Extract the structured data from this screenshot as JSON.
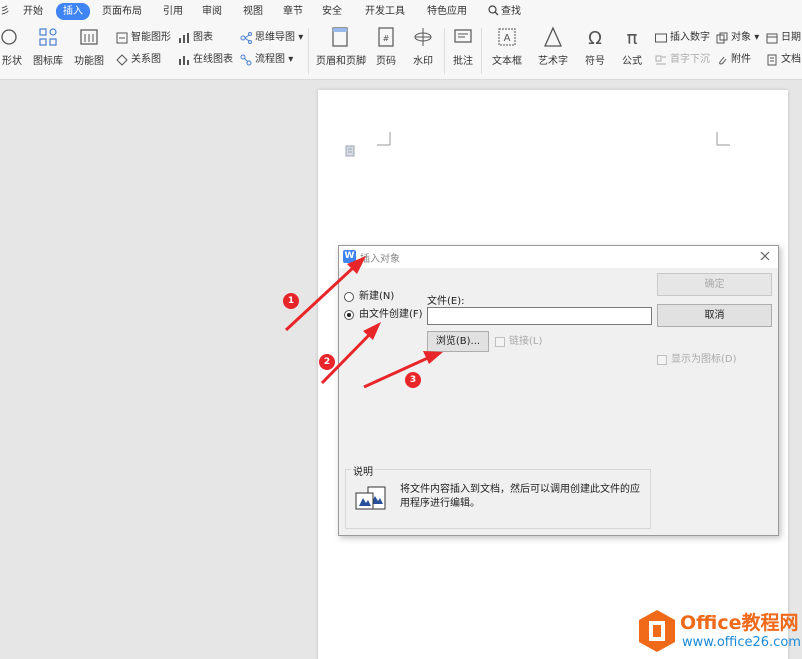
{
  "menu": {
    "tabs": [
      "开始",
      "插入",
      "页面布局",
      "引用",
      "审阅",
      "视图",
      "章节",
      "安全",
      "开发工具",
      "特色应用"
    ],
    "leading_fragment": "彡",
    "search_label": "查找",
    "accent": "#3f84f3"
  },
  "ribbon": {
    "shape_fragment": "形状",
    "icon_lib": "图标库",
    "func_chart": "功能图",
    "smart_shape": "智能图形",
    "chart": "图表",
    "mind_map": "思维导图",
    "relation_chart": "关系图",
    "online_chart": "在线图表",
    "flow_chart": "流程图",
    "header_footer": "页眉和页脚",
    "page_number": "页码",
    "watermark": "水印",
    "comment": "批注",
    "textbox": "文本框",
    "art_text": "艺术字",
    "symbol": "符号",
    "formula": "公式",
    "insert_number": "插入数字",
    "drop_cap": "首字下沉",
    "object": "对象",
    "attachment": "附件",
    "date_fragment": "日期",
    "doc_fragment": "文档"
  },
  "dialog": {
    "title": "插入对象",
    "radio_new": "新建(N)",
    "radio_from_file": "由文件创建(F)",
    "selected": "from_file",
    "file_label": "文件(E):",
    "file_value": "",
    "browse_button": "浏览(B)...",
    "link_checkbox": "链接(L)",
    "ok_button": "确定",
    "cancel_button": "取消",
    "display_as_icon": "显示为图标(D)",
    "desc_legend": "说明",
    "desc_text": "将文件内容插入到文档，然后可以调用创建此文件的应用程序进行编辑。"
  },
  "annotations": [
    "1",
    "2",
    "3"
  ],
  "annotation_color": "#e8262a",
  "watermark": {
    "title": "Office教程网",
    "url": "www.office26.com",
    "title_color": "#f06a1a",
    "url_color": "#1a8ad6"
  }
}
